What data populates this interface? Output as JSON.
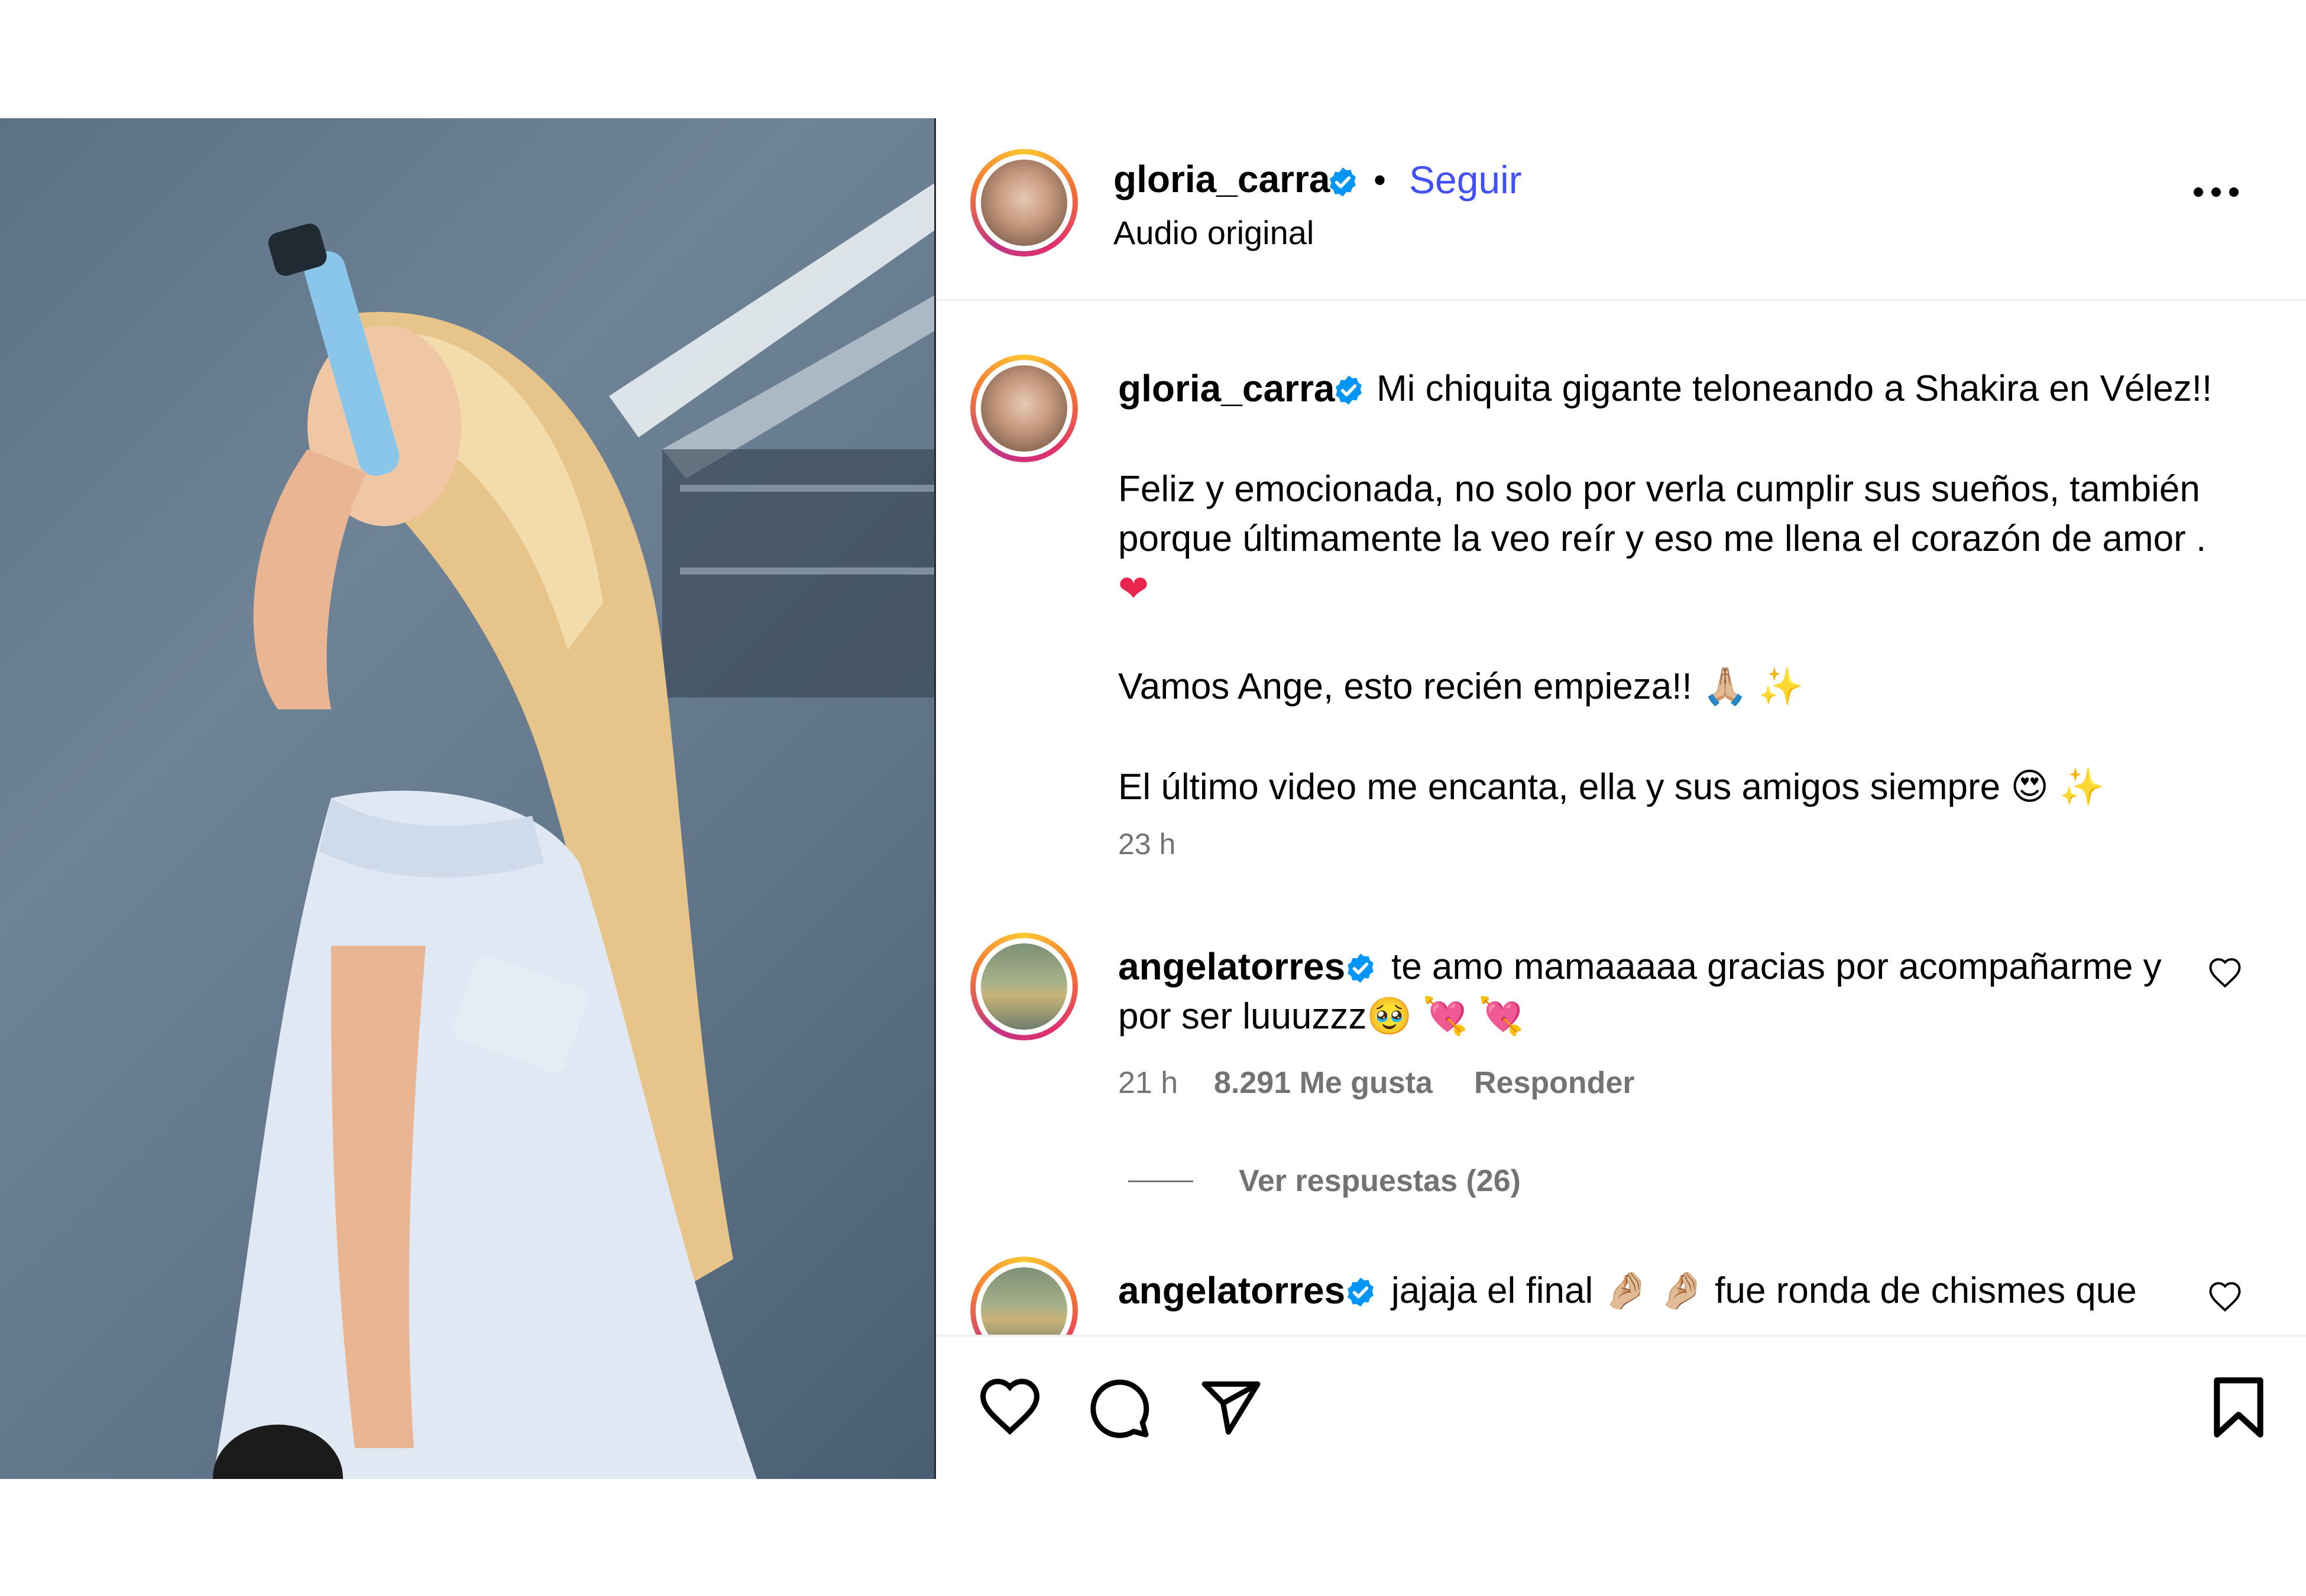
{
  "header": {
    "username": "gloria_carra",
    "separator": "•",
    "follow_label": "Seguir",
    "audio_label": "Audio original"
  },
  "caption": {
    "username": "gloria_carra",
    "line1": "Mi chiquita gigante teloneando a Shakira en Vélez!!",
    "para2_line1": "Feliz y emocionada, no solo por verla cumplir sus sueños, también",
    "para2_line2": "porque últimamente la veo reír y eso me llena el corazón de amor .",
    "para2_emoji": "❤",
    "para3": "Vamos Ange, esto recién empieza!! 🙏🏼 ✨",
    "para4": "El último video me encanta, ella y sus amigos siempre 😍 ✨",
    "time": "23 h"
  },
  "comments": [
    {
      "username": "angelatorres",
      "text_line1": "te amo mamaaaaa gracias por acompañarme y",
      "text_line2": "por ser luuuzzz🥹 💘 💘",
      "time": "21 h",
      "likes": "8.291 Me gusta",
      "reply_label": "Responder",
      "view_replies": "Ver respuestas (26)"
    },
    {
      "username": "angelatorres",
      "text_line1": "jajaja el final 🤌🏼 🤌🏼  fue ronda de chismes que"
    }
  ],
  "icons": {
    "more": "more-icon",
    "like": "heart-icon",
    "comment": "comment-icon",
    "share": "share-icon",
    "save": "bookmark-icon",
    "verified": "verified-badge-icon",
    "comment_like": "heart-icon"
  },
  "colors": {
    "link_blue": "#4150f7",
    "verified_blue": "#0095f6",
    "muted_gray": "#737373"
  }
}
